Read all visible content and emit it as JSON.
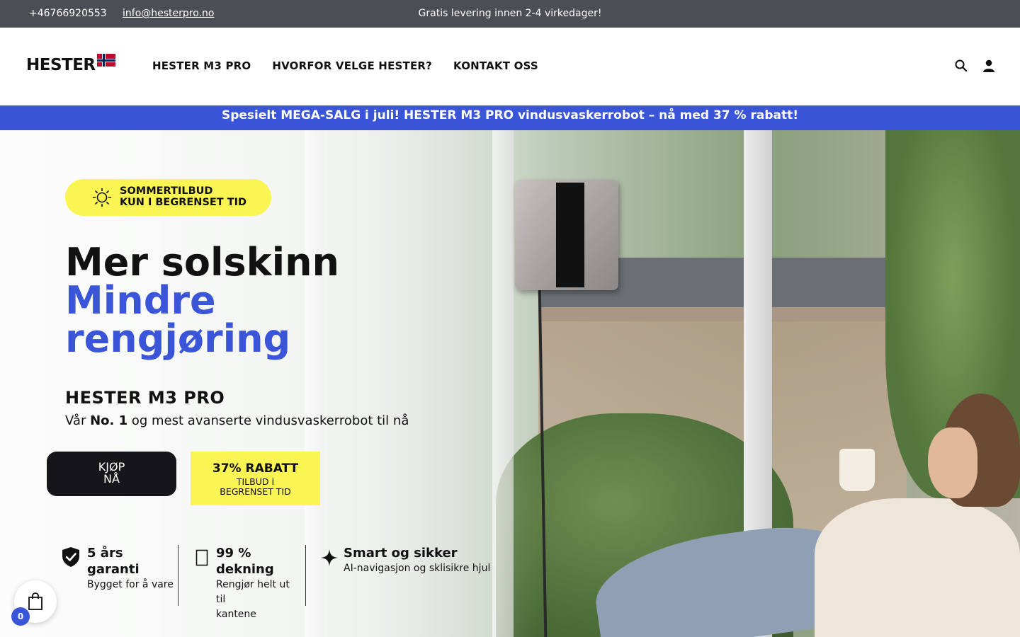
{
  "topbar": {
    "phone": "+46766920553",
    "email": "info@hesterpro.no",
    "promo": "Gratis levering innen 2-4 virkedager!"
  },
  "header": {
    "logo_text": "HESTER",
    "nav": [
      "HESTER M3 PRO",
      "HVORFOR VELGE HESTER?",
      "KONTAKT OSS"
    ],
    "icons": [
      "search-icon",
      "account-icon"
    ]
  },
  "announcement": "Spesielt MEGA-SALG i juli! HESTER M3 PRO vindusvaskerrobot – nå med 37 % rabatt!",
  "hero": {
    "badge_line1": "SOMMERTILBUD",
    "badge_line2": "KUN I BEGRENSET TID",
    "headline_line1": "Mer solskinn",
    "headline_line2": "Mindre",
    "headline_line3": "rengjøring",
    "product_name": "HESTER M3 PRO",
    "tagline_pre": "Vår ",
    "tagline_bold": "No. 1",
    "tagline_post": " og mest avanserte vindusvaskerrobot til nå",
    "buy_line1": "KJØP",
    "buy_line2": "NÅ",
    "discount_big": "37% RABATT",
    "discount_small1": "TILBUD I",
    "discount_small2": "BEGRENSET TID"
  },
  "features": [
    {
      "title_l1": "5 års",
      "title_l2": "garanti",
      "sub_l1": "Bygget for å vare",
      "sub_l2": "",
      "icon": "shield-check-icon"
    },
    {
      "title_l1": "99 %",
      "title_l2": "dekning",
      "sub_l1": "Rengjør helt ut til",
      "sub_l2": "kantene",
      "icon": "coverage-icon"
    },
    {
      "title_l1": "Smart og sikker",
      "title_l2": "",
      "sub_l1": "AI-navigasjon og sklisikre hjul",
      "sub_l2": "",
      "icon": "sparkle-icon"
    }
  ],
  "cart": {
    "count": "0",
    "icon": "shopping-bag-icon"
  },
  "colors": {
    "accent_blue": "#3a55d8",
    "highlight_yellow": "#fbf554",
    "topbar_gray": "#4d4d55",
    "button_dark": "#15151a"
  }
}
